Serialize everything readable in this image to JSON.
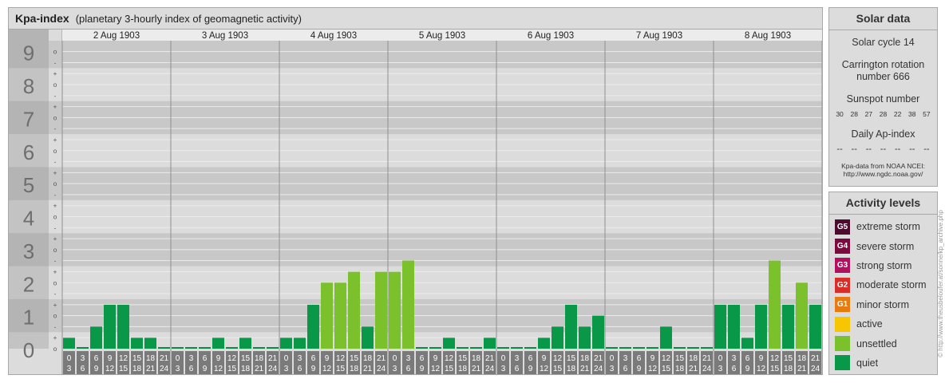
{
  "header": {
    "title": "Kpa-index",
    "subtitle": "(planetary 3-hourly index of geomagnetic activity)"
  },
  "chart_data": {
    "type": "bar",
    "y_ticks": [
      "0",
      "1",
      "2",
      "3",
      "4",
      "5",
      "6",
      "7",
      "8",
      "9"
    ],
    "sub_ticks": [
      "+",
      "o",
      "-"
    ],
    "ylim": [
      0,
      9.33
    ],
    "days": [
      "2 Aug 1903",
      "3 Aug 1903",
      "4 Aug 1903",
      "5 Aug 1903",
      "6 Aug 1903",
      "7 Aug 1903",
      "8 Aug 1903"
    ],
    "intervals": [
      [
        "0",
        "3"
      ],
      [
        "3",
        "6"
      ],
      [
        "6",
        "9"
      ],
      [
        "9",
        "12"
      ],
      [
        "12",
        "15"
      ],
      [
        "15",
        "18"
      ],
      [
        "18",
        "21"
      ],
      [
        "21",
        "24"
      ]
    ],
    "values": [
      [
        0.33,
        0,
        0.67,
        1.33,
        1.33,
        0.33,
        0.33,
        0
      ],
      [
        0,
        0,
        0,
        0.33,
        0,
        0.33,
        0,
        0
      ],
      [
        0.33,
        0.33,
        1.33,
        2,
        2,
        2.33,
        0.67,
        2.33
      ],
      [
        2.33,
        2.67,
        0,
        0,
        0.33,
        0,
        0,
        0.33
      ],
      [
        0,
        0,
        0,
        0.33,
        0.67,
        1.33,
        0.67,
        1
      ],
      [
        0,
        0,
        0,
        0,
        0.67,
        0,
        0,
        0
      ],
      [
        1.33,
        1.33,
        0.33,
        1.33,
        2.67,
        1.33,
        2,
        1.33
      ]
    ],
    "colors": {
      "quiet": "#089848",
      "unsettled": "#7ac12b",
      "zero": "#078a41"
    }
  },
  "solar": {
    "title": "Solar data",
    "cycle": "Solar cycle 14",
    "carrington": "Carrington rotation number 666",
    "sunspot_label": "Sunspot number",
    "sunspots": [
      "30",
      "28",
      "27",
      "28",
      "22",
      "38",
      "57"
    ],
    "ap_label": "Daily Ap-index",
    "ap_values": [
      "--",
      "--",
      "--",
      "--",
      "--",
      "--",
      "--"
    ],
    "source_line1": "Kpa-data from NOAA NCEI:",
    "source_line2": "http://www.ngdc.noaa.gov/"
  },
  "activity": {
    "title": "Activity levels",
    "levels": [
      {
        "badge": "G5",
        "label": "extreme storm",
        "color": "#4e0b2d"
      },
      {
        "badge": "G4",
        "label": "severe storm",
        "color": "#7d0a3f"
      },
      {
        "badge": "G3",
        "label": "strong storm",
        "color": "#b0105e"
      },
      {
        "badge": "G2",
        "label": "moderate storm",
        "color": "#d92d27"
      },
      {
        "badge": "G1",
        "label": "minor storm",
        "color": "#e87a12"
      },
      {
        "badge": "",
        "label": "active",
        "color": "#f6c600"
      },
      {
        "badge": "",
        "label": "unsettled",
        "color": "#7ac12b"
      },
      {
        "badge": "",
        "label": "quiet",
        "color": "#089848"
      }
    ]
  },
  "credit": "© http://www.theusbeloufer.at/sonne/kp_archive.php"
}
